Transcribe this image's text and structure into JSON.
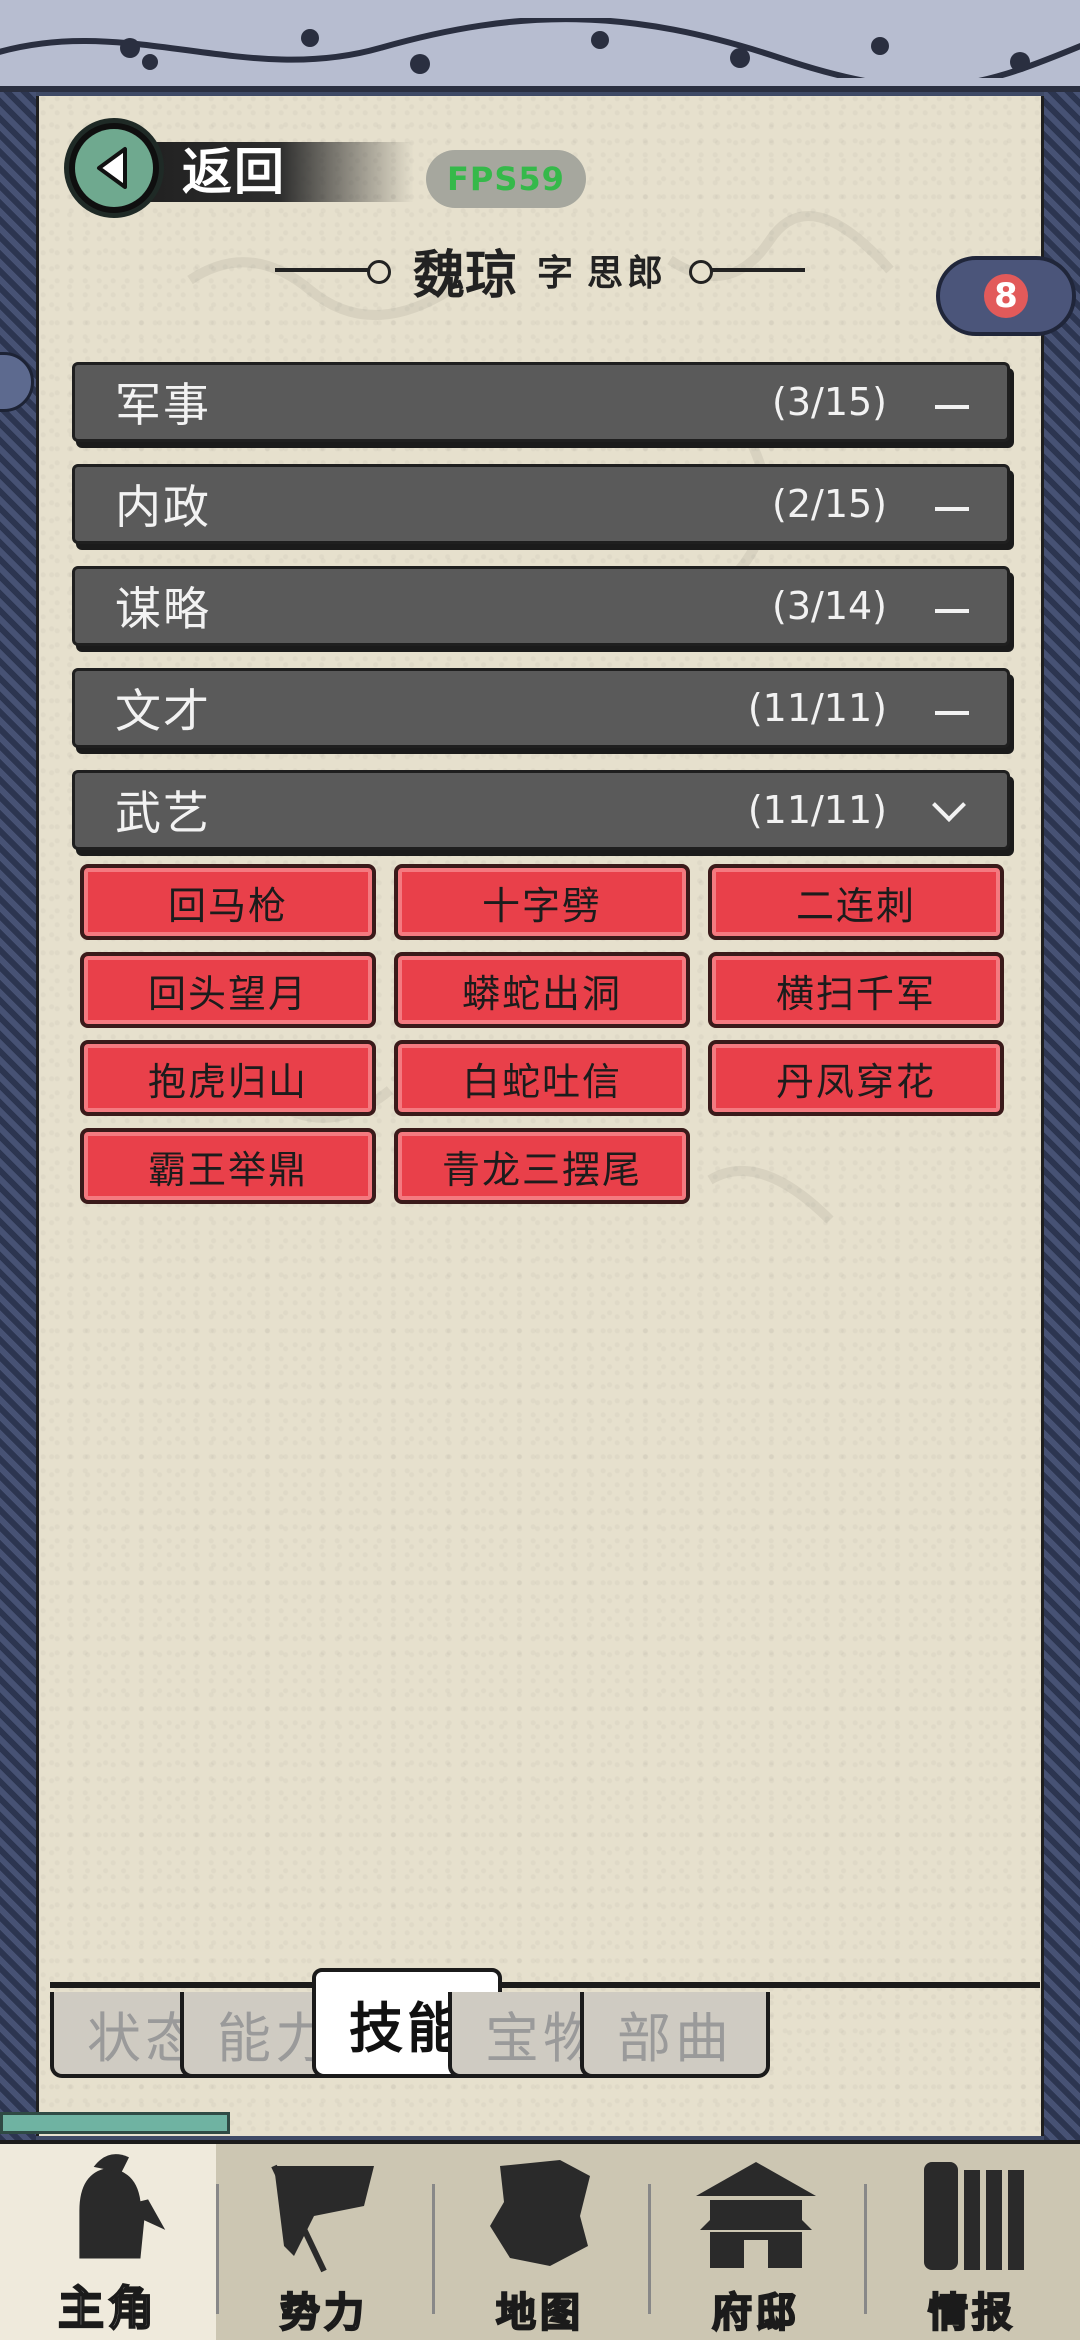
{
  "header": {
    "back_label": "返回",
    "fps_text": "FPS59"
  },
  "hero": {
    "name": "魏琼",
    "courtesy_prefix": "字",
    "courtesy_name": "思郎"
  },
  "badge": {
    "count": "8"
  },
  "categories": [
    {
      "label": "军事",
      "count": "(3/15)",
      "state": "collapsed"
    },
    {
      "label": "内政",
      "count": "(2/15)",
      "state": "collapsed"
    },
    {
      "label": "谋略",
      "count": "(3/14)",
      "state": "collapsed"
    },
    {
      "label": "文才",
      "count": "(11/11)",
      "state": "collapsed"
    },
    {
      "label": "武艺",
      "count": "(11/11)",
      "state": "expanded"
    }
  ],
  "skills": [
    "回马枪",
    "十字劈",
    "二连刺",
    "回头望月",
    "蟒蛇出洞",
    "横扫千军",
    "抱虎归山",
    "白蛇吐信",
    "丹凤穿花",
    "霸王举鼎",
    "青龙三摆尾"
  ],
  "tabs": [
    {
      "label": "状态",
      "active": false
    },
    {
      "label": "能力",
      "active": false
    },
    {
      "label": "技能",
      "active": true
    },
    {
      "label": "宝物",
      "active": false
    },
    {
      "label": "部曲",
      "active": false
    }
  ],
  "nav": [
    {
      "label": "主角",
      "icon": "hero-silhouette-icon",
      "active": true
    },
    {
      "label": "势力",
      "icon": "flag-icon",
      "active": false
    },
    {
      "label": "地图",
      "icon": "map-icon",
      "active": false
    },
    {
      "label": "府邸",
      "icon": "mansion-icon",
      "active": false
    },
    {
      "label": "情报",
      "icon": "scroll-icon",
      "active": false
    }
  ],
  "colors": {
    "paper": "#e6e0cd",
    "category_bar": "#5a5a5a",
    "skill_button": "#e9404a",
    "back_circle": "#6fa98f",
    "fps_text": "#35b94a"
  }
}
